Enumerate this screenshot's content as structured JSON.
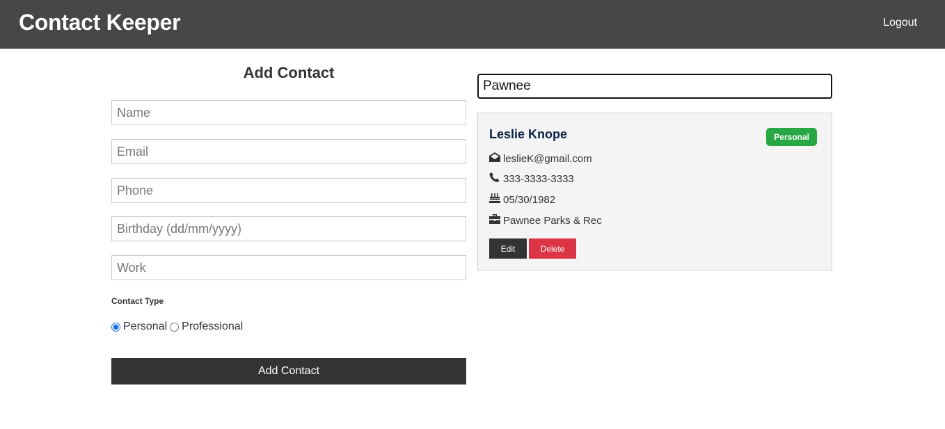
{
  "navbar": {
    "brand": "Contact Keeper",
    "logout_label": "Logout"
  },
  "form": {
    "title": "Add Contact",
    "fields": {
      "name_placeholder": "Name",
      "email_placeholder": "Email",
      "phone_placeholder": "Phone",
      "birthday_placeholder": "Birthday (dd/mm/yyyy)",
      "work_placeholder": "Work"
    },
    "contact_type_label": "Contact Type",
    "type_options": {
      "personal": "Personal",
      "professional": "Professional"
    },
    "selected_type": "personal",
    "submit_label": "Add Contact"
  },
  "filter": {
    "value": "Pawnee"
  },
  "contacts": [
    {
      "name": "Leslie Knope",
      "type": "Personal",
      "email": "leslieK@gmail.com",
      "phone": "333-3333-3333",
      "birthday": "05/30/1982",
      "work": "Pawnee Parks & Rec",
      "edit_label": "Edit",
      "delete_label": "Delete"
    }
  ],
  "colors": {
    "navbar_bg": "#474747",
    "badge_personal": "#28a745",
    "delete_button": "#dc3545",
    "dark_button": "#333333"
  },
  "icons": {
    "email": "envelope-open-icon",
    "phone": "phone-icon",
    "birthday": "birthday-cake-icon",
    "work": "briefcase-icon"
  }
}
